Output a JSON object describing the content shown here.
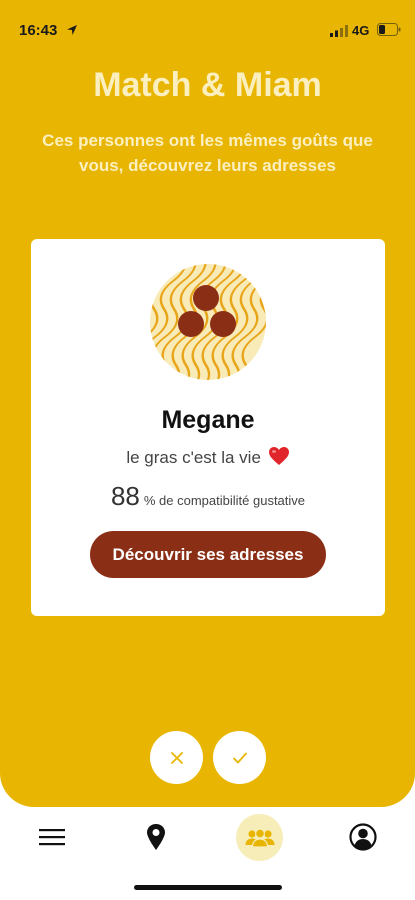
{
  "status_bar": {
    "time": "16:43",
    "network": "4G"
  },
  "header": {
    "title": "Match & Miam",
    "subtitle": "Ces personnes ont les mêmes goûts que vous, découvrez leurs adresses"
  },
  "profile_card": {
    "name": "Megane",
    "bio": "le gras c'est la vie",
    "compatibility_value": "88",
    "compatibility_label": "% de compatibilité gustative",
    "cta_label": "Découvrir ses adresses"
  },
  "actions": {
    "reject_icon": "close-icon",
    "accept_icon": "check-icon"
  },
  "tab_bar": {
    "items": [
      {
        "icon": "menu-icon",
        "active": false
      },
      {
        "icon": "map-pin-icon",
        "active": false
      },
      {
        "icon": "users-icon",
        "active": true
      },
      {
        "icon": "user-circle-icon",
        "active": false
      }
    ]
  },
  "colors": {
    "background": "#E8B602",
    "header_text": "#FBEFC0",
    "cta": "#8B2E16",
    "avatar_dots": "#8B2E16",
    "active_tab_bg": "#F6EDB8"
  }
}
